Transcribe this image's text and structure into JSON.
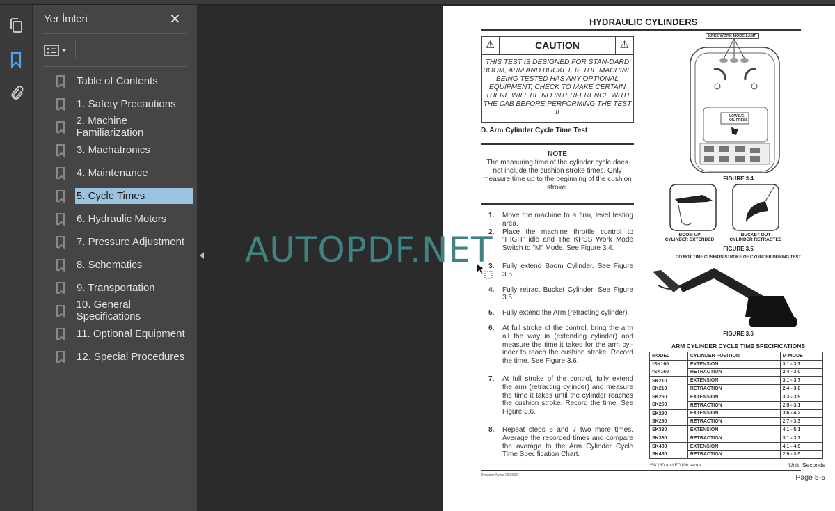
{
  "sidebar": {
    "title": "Yer İmleri",
    "icons": [
      "pages-icon",
      "bookmark-icon",
      "attachment-icon"
    ],
    "items": [
      {
        "label": "Table of Contents"
      },
      {
        "label": "1. Safety Precautions"
      },
      {
        "label": "2. Machine Familiarization"
      },
      {
        "label": "3. Machatronics"
      },
      {
        "label": "4. Maintenance"
      },
      {
        "label": "5. Cycle Times",
        "selected": true
      },
      {
        "label": "6. Hydraulic Motors"
      },
      {
        "label": "7. Pressure Adjustment"
      },
      {
        "label": "8. Schematics"
      },
      {
        "label": "9. Transportation"
      },
      {
        "label": "10. General Specifications"
      },
      {
        "label": "11. Optional Equipment"
      },
      {
        "label": "12. Special Procedures"
      }
    ]
  },
  "watermark": "AUTOPDF.NET",
  "page": {
    "title": "HYDRAULIC CYLINDERS",
    "caution": {
      "heading": "CAUTION",
      "text": "THIS TEST IS DESIGNED FOR STAN-DARD BOOM, ARM AND BUCKET. IF THE MACHINE BEING TESTED HAS ANY OPTIONAL EQUIPMENT, CHECK TO MAKE CERTAIN THERE WILL BE NO INTERFERENCE WITH THE CAB BEFORE PERFORMING THE TEST !!"
    },
    "section": "D.  Arm Cylinder Cycle Time Test",
    "note": {
      "heading": "NOTE",
      "text": "The measuring time of the cylinder cycle does not include the cushion stroke times. Only measure time up to the beginning of the cushion stroke."
    },
    "steps": [
      {
        "n": "1.",
        "text": "Move the machine to a firm, level testing area."
      },
      {
        "n": "2.",
        "text": "Place the machine throttle control to \"HIGH\" idle and The KPSS Work Mode Switch to \"M\" Mode. See Figure 3.4."
      },
      {
        "n": "3.",
        "text": "Fully extend Boom Cylinder. See Figure 3.5."
      },
      {
        "n": "4.",
        "text": "Fully retract Bucket Cylinder. See Figure 3.5."
      },
      {
        "n": "5.",
        "text": "Fully extend the Arm (retracting cylinder)."
      },
      {
        "n": "6.",
        "text": "At full stroke of the control, bring the arm all the way in (extending cylinder) and measure the time it takes for the arm cyl-inder to reach the cushion stroke. Record the time. See Figure 3.6."
      },
      {
        "n": "7.",
        "text": "At full stroke of the control, fully extend the arm (retracting cylinder) and measure the time it takes until the cylinder reaches the cushion stroke. Record the time. See Figure  3.6."
      },
      {
        "n": "8.",
        "text": "Repeat steps 6 and 7 two more times. Average the recorded times and compare the average to the Arm Cylinder Cycle Time Specification Chart."
      }
    ],
    "fig34": {
      "lamp_label": "KPSS WORK MODE LAMP",
      "lamps": [
        "A",
        "M",
        "P"
      ],
      "gauge1": [
        "H",
        "C"
      ],
      "gauge2": [
        "F",
        "E"
      ],
      "warning": "LOW E/G OIL PRESS",
      "caption": "FIGURE 3.4"
    },
    "fig35": {
      "left": "BOOM UP\nCYLINDER EXTENDED",
      "right": "BUCKET OUT\nCYLINDER RETRACTED",
      "caption": "FIGURE 3.5",
      "warning": "DO NOT TIME CUSHION STROKE OF CYLINDER DURING TEST"
    },
    "fig36": {
      "caption": "FIGURE 3.6"
    },
    "table": {
      "title": "ARM CYLINDER CYCLE TIME SPECIFICATIONS",
      "headers": [
        "MODEL",
        "CYLINDER POSITION",
        "M-MODE"
      ],
      "rows": [
        [
          "*SK160",
          "EXTENSION",
          "3.1 - 3.7"
        ],
        [
          "*SK160",
          "RETRACTION",
          "2.4 - 3.0"
        ],
        [
          "SK210",
          "EXTENSION",
          "3.1 - 3.7"
        ],
        [
          "SK210",
          "RETRACTION",
          "2.4 - 3.0"
        ],
        [
          "SK250",
          "EXTENSION",
          "3.3 - 3.9"
        ],
        [
          "SK250",
          "RETRACTION",
          "2.5 - 3.1"
        ],
        [
          "SK290",
          "EXTENSION",
          "3.6 - 4.2"
        ],
        [
          "SK290",
          "RETRACTION",
          "2.7 - 3.3"
        ],
        [
          "SK330",
          "EXTENSION",
          "4.1 - 5.1"
        ],
        [
          "SK330",
          "RETRACTION",
          "3.1 - 3.7"
        ],
        [
          "SK480",
          "EXTENSION",
          "4.1 - 4.9"
        ],
        [
          "SK480",
          "RETRACTION",
          "2.9 - 3.5"
        ]
      ],
      "footnote": "*SK160 and ED190 same",
      "unit": "Unit: Seconds"
    },
    "footer_left": "Dynamic Acera 06/2002",
    "page_number": "Page 5-5"
  }
}
